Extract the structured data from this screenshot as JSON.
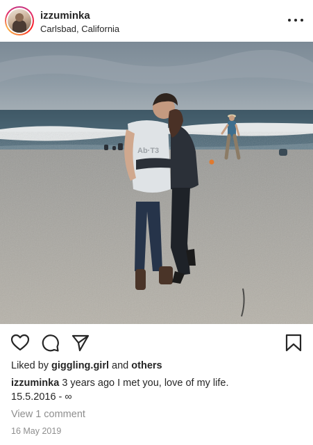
{
  "post": {
    "username": "izzuminka",
    "location": "Carlsbad, California"
  },
  "photo": {
    "description_icon": "beach-couple-photo"
  },
  "icons": {
    "like": "heart-icon",
    "comment": "comment-icon",
    "share": "send-icon",
    "save": "bookmark-icon",
    "more": "more-options-icon"
  },
  "likes": {
    "prefix": "Liked by",
    "user": "giggling.girl",
    "conjunction": "and",
    "others": "others"
  },
  "caption": {
    "author": "izzuminka",
    "text": "3 years ago I met you, love of my life.",
    "line2": "15.5.2016 - ∞"
  },
  "comments": {
    "view_label": "View 1 comment"
  },
  "timestamp": "16 May 2019",
  "colors": {
    "text": "#262626",
    "secondary": "#8e8e8e",
    "background": "#ffffff"
  }
}
